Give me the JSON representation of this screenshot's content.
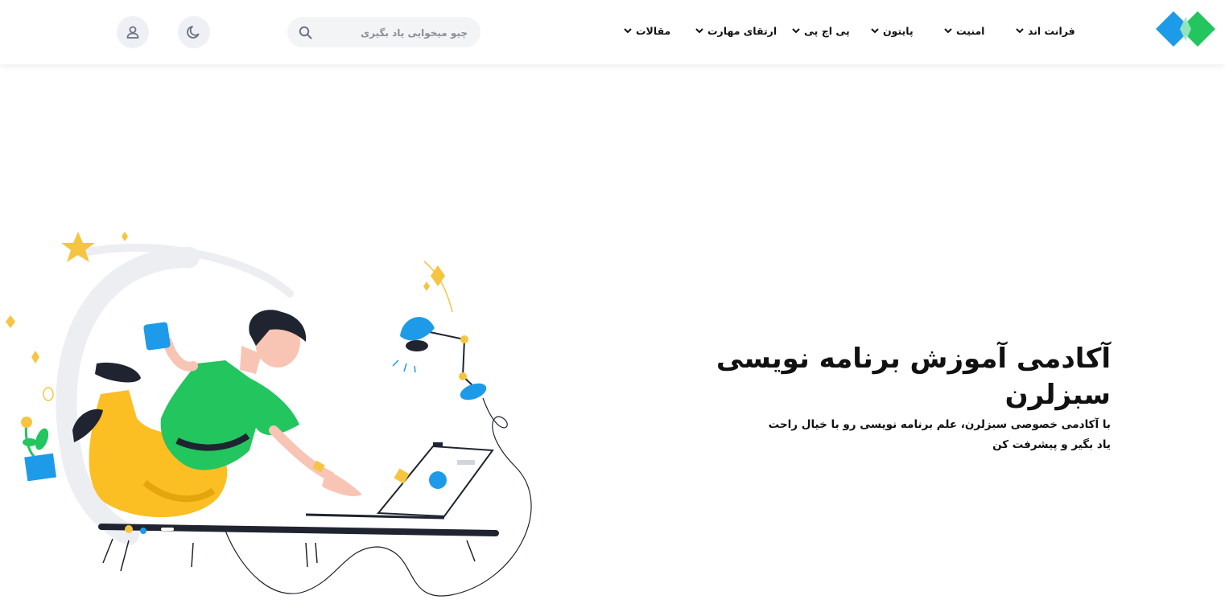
{
  "header": {
    "nav": [
      {
        "label": "فرانت اند"
      },
      {
        "label": "امنیت"
      },
      {
        "label": "پایتون"
      },
      {
        "label": "پی اچ پی"
      },
      {
        "label": "ارتقای مهارت"
      },
      {
        "label": "مقالات"
      }
    ],
    "search": {
      "placeholder": "چیو میخوایی یاد بگیری",
      "icon": "search-icon"
    },
    "theme_toggle": {
      "icon": "moon-icon"
    },
    "account": {
      "icon": "user-icon"
    }
  },
  "hero": {
    "title": "آکادمی آموزش برنامه نویسی سبزلرن",
    "subtitle": "با آکادمی خصوصی سبزلرن، علم برنامه نویسی رو با خیال راحت یاد بگیر و پیشرفت کن"
  },
  "colors": {
    "logo_blue": "#1e9be8",
    "logo_green": "#22c55e",
    "shirt_green": "#22c55e",
    "pants_yellow": "#fbbf24",
    "accent_blue": "#1e9be8",
    "dark": "#1f2430"
  }
}
